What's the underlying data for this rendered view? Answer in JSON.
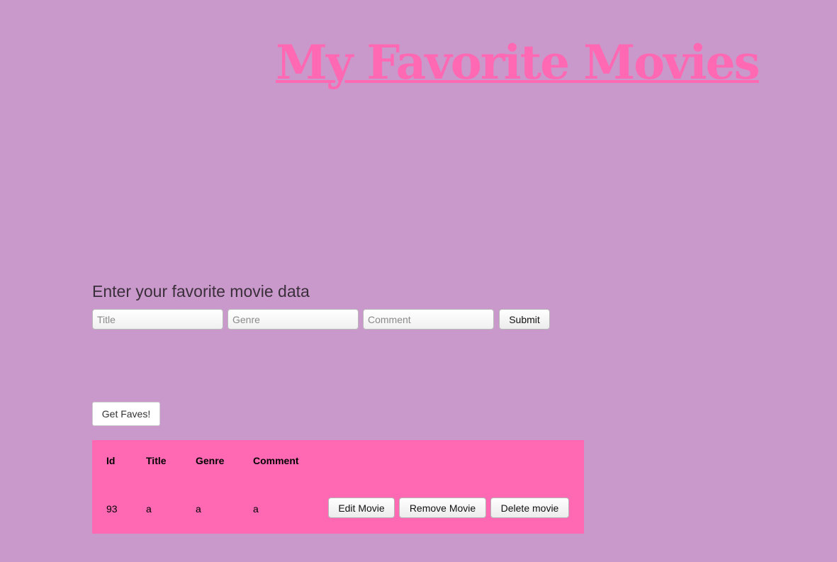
{
  "header": {
    "title": "My Favorite Movies"
  },
  "form": {
    "heading": "Enter your favorite movie data",
    "title_placeholder": "Title",
    "genre_placeholder": "Genre",
    "comment_placeholder": "Comment",
    "submit_label": "Submit"
  },
  "faves": {
    "button_label": "Get Faves!"
  },
  "table": {
    "columns": [
      "Id",
      "Title",
      "Genre",
      "Comment"
    ],
    "rows": [
      {
        "id": "93",
        "title": "a",
        "genre": "a",
        "comment": "a",
        "actions": {
          "edit_label": "Edit Movie",
          "remove_label": "Remove Movie",
          "delete_label": "Delete movie"
        }
      }
    ]
  },
  "colors": {
    "background": "#c999cb",
    "accent": "#ff69b4"
  }
}
